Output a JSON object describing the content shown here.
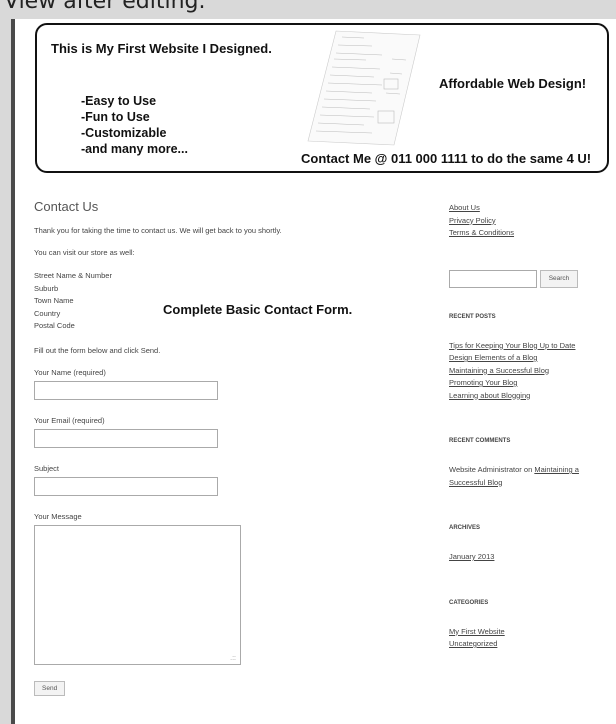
{
  "caption": "View after editing.",
  "banner": {
    "title": "This is My First Website I Designed.",
    "features": [
      "-Easy to Use",
      "-Fun to Use",
      "-Customizable",
      "-and many more..."
    ],
    "tagline": "Affordable Web Design!",
    "contact": "Contact Me @ 011 000 1111 to do the same 4 U!"
  },
  "overlay_label": "Complete Basic Contact Form.",
  "content": {
    "heading": "Contact Us",
    "thanks": "Thank you for taking the time to contact us. We will get back to you shortly.",
    "visit": "You can visit our store as well:",
    "address": [
      "Street Name & Number",
      "Suburb",
      "Town Name",
      "Country",
      "Postal Code"
    ],
    "instructions": "Fill out the form below and click Send.",
    "fields": {
      "name_label": "Your Name (required)",
      "email_label": "Your Email (required)",
      "subject_label": "Subject",
      "message_label": "Your Message"
    },
    "send_label": "Send"
  },
  "sidebar": {
    "links": [
      "About Us",
      "Privacy Policy",
      "Terms & Conditions"
    ],
    "search_button": "Search",
    "recent_posts_title": "RECENT POSTS",
    "recent_posts": [
      "Tips for Keeping Your Blog Up to Date",
      "Design Elements of a Blog",
      "Maintaining a Successful Blog",
      "Promoting Your Blog",
      "Learning about Blogging"
    ],
    "recent_comments_title": "RECENT COMMENTS",
    "comment_author": "Website Administrator",
    "comment_on": " on ",
    "comment_link": "Maintaining a Successful Blog",
    "archives_title": "ARCHIVES",
    "archives": [
      "January 2013"
    ],
    "categories_title": "CATEGORIES",
    "categories": [
      "My First Website",
      "Uncategorized"
    ]
  }
}
